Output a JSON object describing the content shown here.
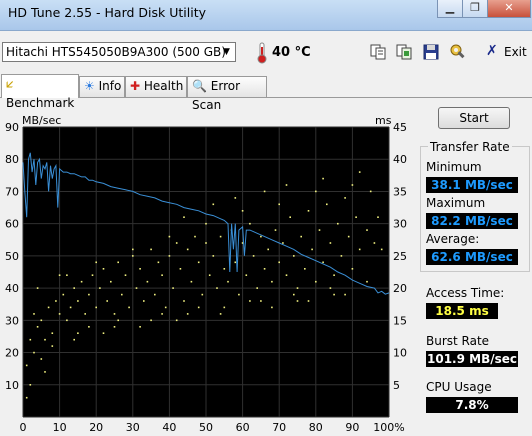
{
  "window": {
    "title": "HD Tune 2.55 - Hard Disk Utility",
    "minimize_glyph": "▁",
    "restore_glyph": "❐",
    "close_glyph": "✕"
  },
  "toolbar": {
    "drive": "Hitachi HTS545050B9A300 (500 GB)",
    "temperature": "40 °C",
    "exit_label": "Exit",
    "icons": [
      "copy-icon",
      "copy-image-icon",
      "save-icon",
      "options-icon",
      "exit-icon"
    ]
  },
  "tabs": [
    {
      "label": "Benchmark",
      "icon": "benchmark-icon",
      "active": true
    },
    {
      "label": "Info",
      "icon": "info-icon",
      "active": false
    },
    {
      "label": "Health",
      "icon": "health-icon",
      "active": false
    },
    {
      "label": "Error Scan",
      "icon": "error-scan-icon",
      "active": false
    }
  ],
  "panel": {
    "start_label": "Start",
    "transfer_rate_label": "Transfer Rate",
    "minimum_label": "Minimum",
    "minimum_value": "38.1 MB/sec",
    "maximum_label": "Maximum",
    "maximum_value": "82.2 MB/sec",
    "average_label": "Average:",
    "average_value": "62.6 MB/sec",
    "access_time_label": "Access Time:",
    "access_time_value": "18.5 ms",
    "burst_rate_label": "Burst Rate",
    "burst_rate_value": "101.9 MB/sec",
    "cpu_usage_label": "CPU Usage",
    "cpu_usage_value": "7.8%"
  },
  "colors": {
    "plot_background": "#000000",
    "grid": "#303030",
    "transfer_line": "#3a8fd6",
    "access_points": "#f0f080",
    "blue_value": "#1e9bff",
    "yellow_value": "#ffff44"
  },
  "chart_data": {
    "type": "line",
    "ylabel_left": "MB/sec",
    "ylabel_right": "ms",
    "y_left_lim": [
      0,
      90
    ],
    "y_right_lim": [
      0,
      45
    ],
    "x_lim": [
      0,
      100
    ],
    "x_ticks": [
      "0",
      "10",
      "20",
      "30",
      "40",
      "50",
      "60",
      "70",
      "80",
      "90",
      "100%"
    ],
    "y_left_ticks": [
      "10",
      "20",
      "30",
      "40",
      "50",
      "60",
      "70",
      "80",
      "90"
    ],
    "y_right_ticks": [
      "5",
      "10",
      "15",
      "20",
      "25",
      "30",
      "35",
      "40",
      "45"
    ],
    "grid": true,
    "series": [
      {
        "kind": "transfer_rate_line",
        "points": [
          [
            0,
            79
          ],
          [
            0.5,
            70
          ],
          [
            1,
            62
          ],
          [
            1.5,
            80
          ],
          [
            2,
            82
          ],
          [
            2.5,
            76
          ],
          [
            3,
            80
          ],
          [
            3.5,
            72
          ],
          [
            4,
            79
          ],
          [
            4.5,
            80
          ],
          [
            5,
            74
          ],
          [
            5.5,
            78
          ],
          [
            6,
            77
          ],
          [
            6.5,
            79
          ],
          [
            7,
            70
          ],
          [
            7.5,
            78
          ],
          [
            8,
            74
          ],
          [
            8.5,
            77
          ],
          [
            9,
            78
          ],
          [
            9.5,
            65
          ],
          [
            10,
            77
          ],
          [
            11,
            76
          ],
          [
            12,
            76
          ],
          [
            13,
            75.5
          ],
          [
            14,
            75.5
          ],
          [
            15,
            75
          ],
          [
            16,
            74.5
          ],
          [
            17,
            74.5
          ],
          [
            18,
            73.5
          ],
          [
            19,
            73.5
          ],
          [
            20,
            73
          ],
          [
            22,
            72.5
          ],
          [
            24,
            71.5
          ],
          [
            26,
            71
          ],
          [
            28,
            70.5
          ],
          [
            30,
            70
          ],
          [
            32,
            69
          ],
          [
            34,
            68.5
          ],
          [
            36,
            68
          ],
          [
            38,
            67
          ],
          [
            40,
            66.5
          ],
          [
            42,
            66
          ],
          [
            44,
            65
          ],
          [
            46,
            64.5
          ],
          [
            48,
            64
          ],
          [
            50,
            63
          ],
          [
            52,
            62.5
          ],
          [
            54,
            61.5
          ],
          [
            55,
            61
          ],
          [
            56,
            60
          ],
          [
            56.5,
            45
          ],
          [
            57,
            60
          ],
          [
            57.5,
            52
          ],
          [
            58,
            60
          ],
          [
            58.5,
            45
          ],
          [
            59,
            58
          ],
          [
            60,
            59
          ],
          [
            60.5,
            50
          ],
          [
            61,
            58
          ],
          [
            62,
            58
          ],
          [
            63,
            57.5
          ],
          [
            64,
            57
          ],
          [
            66,
            56
          ],
          [
            68,
            55
          ],
          [
            70,
            54
          ],
          [
            72,
            53
          ],
          [
            74,
            52
          ],
          [
            76,
            50.5
          ],
          [
            78,
            49.5
          ],
          [
            80,
            48.5
          ],
          [
            82,
            47.5
          ],
          [
            84,
            46.5
          ],
          [
            86,
            45
          ],
          [
            88,
            44
          ],
          [
            90,
            42.5
          ],
          [
            92,
            41.5
          ],
          [
            94,
            40.5
          ],
          [
            96,
            40
          ],
          [
            97,
            38.5
          ],
          [
            98,
            39
          ],
          [
            99,
            38.1
          ],
          [
            100,
            38.5
          ]
        ]
      },
      {
        "kind": "access_time_points",
        "points": [
          [
            1,
            3
          ],
          [
            2,
            5
          ],
          [
            1,
            8
          ],
          [
            3,
            10
          ],
          [
            2,
            12
          ],
          [
            4,
            14
          ],
          [
            3,
            16
          ],
          [
            5,
            15
          ],
          [
            6,
            12
          ],
          [
            7,
            17
          ],
          [
            8,
            13
          ],
          [
            9,
            18
          ],
          [
            10,
            16
          ],
          [
            11,
            19
          ],
          [
            12,
            15
          ],
          [
            13,
            17
          ],
          [
            14,
            20
          ],
          [
            15,
            18
          ],
          [
            16,
            21
          ],
          [
            17,
            16
          ],
          [
            18,
            19
          ],
          [
            19,
            22
          ],
          [
            20,
            17
          ],
          [
            21,
            20
          ],
          [
            22,
            23
          ],
          [
            23,
            18
          ],
          [
            24,
            21
          ],
          [
            25,
            16
          ],
          [
            26,
            24
          ],
          [
            27,
            19
          ],
          [
            28,
            22
          ],
          [
            29,
            17
          ],
          [
            30,
            25
          ],
          [
            31,
            20
          ],
          [
            32,
            23
          ],
          [
            33,
            18
          ],
          [
            34,
            21
          ],
          [
            35,
            26
          ],
          [
            36,
            19
          ],
          [
            37,
            24
          ],
          [
            38,
            22
          ],
          [
            39,
            17
          ],
          [
            40,
            25
          ],
          [
            41,
            20
          ],
          [
            42,
            27
          ],
          [
            43,
            23
          ],
          [
            44,
            18
          ],
          [
            45,
            26
          ],
          [
            46,
            21
          ],
          [
            47,
            28
          ],
          [
            48,
            24
          ],
          [
            49,
            19
          ],
          [
            50,
            27
          ],
          [
            51,
            22
          ],
          [
            52,
            25
          ],
          [
            53,
            20
          ],
          [
            54,
            28
          ],
          [
            55,
            23
          ],
          [
            56,
            21
          ],
          [
            57,
            29
          ],
          [
            58,
            24
          ],
          [
            59,
            19
          ],
          [
            60,
            27
          ],
          [
            61,
            22
          ],
          [
            62,
            30
          ],
          [
            63,
            25
          ],
          [
            64,
            20
          ],
          [
            65,
            28
          ],
          [
            66,
            23
          ],
          [
            67,
            26
          ],
          [
            68,
            21
          ],
          [
            69,
            29
          ],
          [
            70,
            24
          ],
          [
            71,
            27
          ],
          [
            72,
            22
          ],
          [
            73,
            31
          ],
          [
            74,
            25
          ],
          [
            75,
            20
          ],
          [
            76,
            28
          ],
          [
            77,
            23
          ],
          [
            78,
            32
          ],
          [
            79,
            26
          ],
          [
            80,
            21
          ],
          [
            81,
            29
          ],
          [
            82,
            24
          ],
          [
            83,
            33
          ],
          [
            84,
            27
          ],
          [
            85,
            22
          ],
          [
            86,
            30
          ],
          [
            87,
            25
          ],
          [
            88,
            34
          ],
          [
            89,
            28
          ],
          [
            90,
            23
          ],
          [
            91,
            31
          ],
          [
            92,
            26
          ],
          [
            94,
            29
          ],
          [
            95,
            35
          ],
          [
            96,
            27
          ],
          [
            97,
            31
          ],
          [
            98,
            26
          ],
          [
            5,
            9
          ],
          [
            15,
            13
          ],
          [
            25,
            14
          ],
          [
            35,
            15
          ],
          [
            45,
            16
          ],
          [
            55,
            17
          ],
          [
            65,
            18
          ],
          [
            75,
            18
          ],
          [
            85,
            19
          ],
          [
            10,
            22
          ],
          [
            20,
            24
          ],
          [
            30,
            26
          ],
          [
            40,
            28
          ],
          [
            50,
            30
          ],
          [
            60,
            32
          ],
          [
            70,
            33
          ],
          [
            80,
            35
          ],
          [
            90,
            36
          ],
          [
            4,
            20
          ],
          [
            12,
            22
          ],
          [
            44,
            31
          ],
          [
            52,
            33
          ],
          [
            58,
            34
          ],
          [
            66,
            35
          ],
          [
            72,
            36
          ],
          [
            82,
            37
          ],
          [
            92,
            38
          ],
          [
            6,
            7
          ],
          [
            8,
            11
          ],
          [
            14,
            12
          ],
          [
            18,
            14
          ],
          [
            22,
            13
          ],
          [
            26,
            15
          ],
          [
            32,
            14
          ],
          [
            38,
            16
          ],
          [
            42,
            15
          ],
          [
            48,
            17
          ],
          [
            54,
            16
          ],
          [
            62,
            18
          ],
          [
            68,
            17
          ],
          [
            74,
            19
          ],
          [
            78,
            18
          ],
          [
            84,
            20
          ],
          [
            88,
            19
          ],
          [
            94,
            21
          ]
        ]
      }
    ]
  }
}
